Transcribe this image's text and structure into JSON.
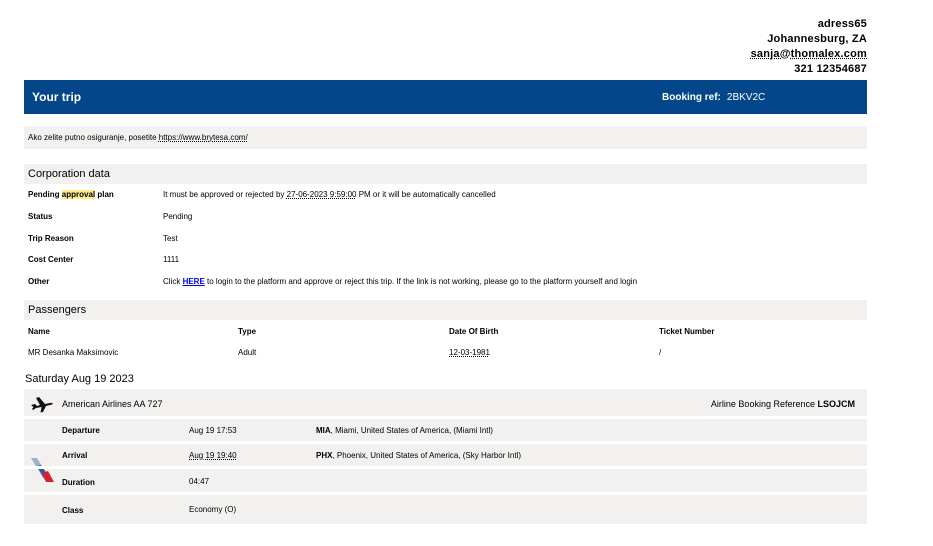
{
  "address": {
    "line1": "adress65",
    "line2": "Johannesburg, ZA",
    "email": "sanja@thomalex.com",
    "phone": "321 12354687"
  },
  "banner": {
    "title": "Your trip",
    "booking_ref_label": "Booking ref:",
    "booking_ref_value": "2BKV2C",
    "color": "#03478a"
  },
  "notice": {
    "text": "Ako zelite putno osiguranje, posetite ",
    "link": "https://www.brytesa.com/"
  },
  "corporation": {
    "heading": "Corporation data",
    "pending_label_a": "Pending ",
    "pending_label_hl": "approval",
    "pending_label_b": " plan",
    "pending_text_a": "It must be approved or rejected by ",
    "pending_deadline": "27-06-2023 9:59:00",
    "pending_text_b": " PM or it will be automatically cancelled",
    "status_label": "Status",
    "status_value": "Pending",
    "reason_label": "Trip Reason",
    "reason_value": "Test",
    "cost_label": "Cost Center",
    "cost_value": "1111",
    "other_label": "Other",
    "other_text_a": "Click ",
    "other_link": "HERE",
    "other_text_b": " to login to the platform and approve or reject this trip. If the link is not working, please go to the platform yourself and login"
  },
  "passengers": {
    "heading": "Passengers",
    "columns": [
      "Name",
      "Type",
      "Date Of Birth",
      "Ticket Number"
    ],
    "rows": [
      {
        "name": "MR Desanka Maksimovic",
        "type": "Adult",
        "dob": "12-03-1981",
        "ticket": "/"
      }
    ]
  },
  "itinerary": {
    "date": "Saturday Aug 19 2023",
    "flight": {
      "carrier": "American Airlines AA 727",
      "abr_label": "Airline Booking Reference ",
      "abr_value": "LSOJCM",
      "departure_label": "Departure",
      "departure_time": "Aug 19 17:53",
      "departure_code": "MIA",
      "departure_place": ", Miami, United States of America, (Miami Intl)",
      "arrival_label": "Arrival",
      "arrival_time": "Aug 19 19:40",
      "arrival_code": "PHX",
      "arrival_place": ", Phoenix, United States of America, (Sky Harbor Intl)",
      "duration_label": "Duration",
      "duration_value": "04:47",
      "class_label": "Class",
      "class_value": "Economy (O)"
    }
  }
}
